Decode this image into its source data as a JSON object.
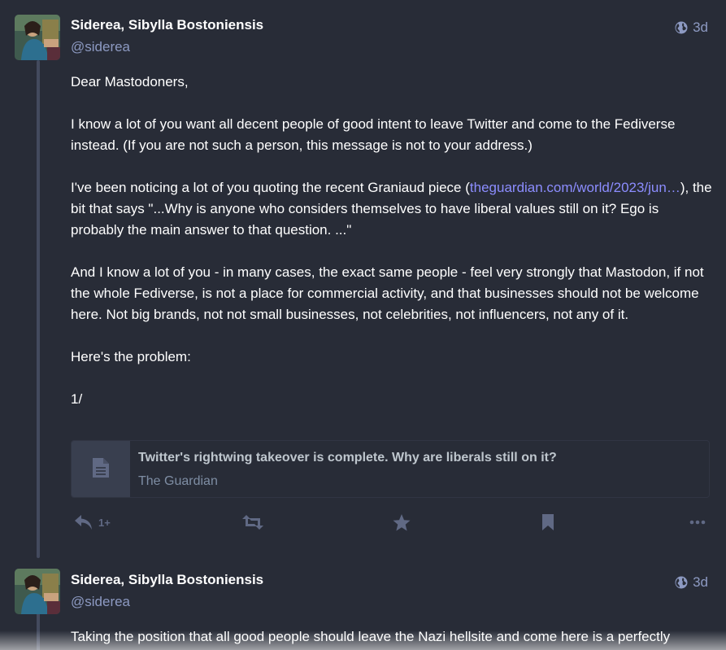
{
  "posts": [
    {
      "display_name": "Siderea, Sibylla Bostoniensis",
      "handle": "@siderea",
      "visibility_icon": "globe-icon",
      "time": "3d",
      "paragraphs": [
        "Dear Mastodoners,",
        "I know a lot of you want all decent people of good intent to leave Twitter and come to the Fediverse instead.  (If you are not such a person, this message is not to your address.)",
        "And I know a lot of you - in many cases, the exact same people - feel very strongly that Mastodon, if not the whole Fediverse, is not a place for commercial activity, and that businesses should not be welcome here. Not big brands, not not small businesses, not celebrities, not influencers, not any of it.",
        "Here's the problem:",
        "1/"
      ],
      "link_paragraph": {
        "before": "I've been noticing a lot of you quoting the recent Graniaud piece (",
        "link_text": "theguardian.com/world/2023/jun…",
        "after": "), the bit that says \"...Why is anyone who considers themselves to have liberal values still on it? Ego is probably the main answer to that question. ...\""
      },
      "card": {
        "icon": "document-icon",
        "title": "Twitter's rightwing takeover is complete. Why are liberals still on it?",
        "provider": "The Guardian"
      },
      "actions": {
        "reply_icon": "reply-icon",
        "reply_count": "1+",
        "boost_icon": "boost-icon",
        "favourite_icon": "star-icon",
        "bookmark_icon": "bookmark-icon",
        "more_icon": "more-icon"
      }
    },
    {
      "display_name": "Siderea, Sibylla Bostoniensis",
      "handle": "@siderea",
      "visibility_icon": "globe-icon",
      "time": "3d",
      "paragraphs": [
        "Taking the position that all good people should leave the Nazi hellsite and come here is a perfectly"
      ]
    }
  ],
  "colors": {
    "background": "#282c37",
    "link": "#8c8dff",
    "muted": "#8d9ac2",
    "thread_line": "#434a5e",
    "action": "#606984"
  }
}
